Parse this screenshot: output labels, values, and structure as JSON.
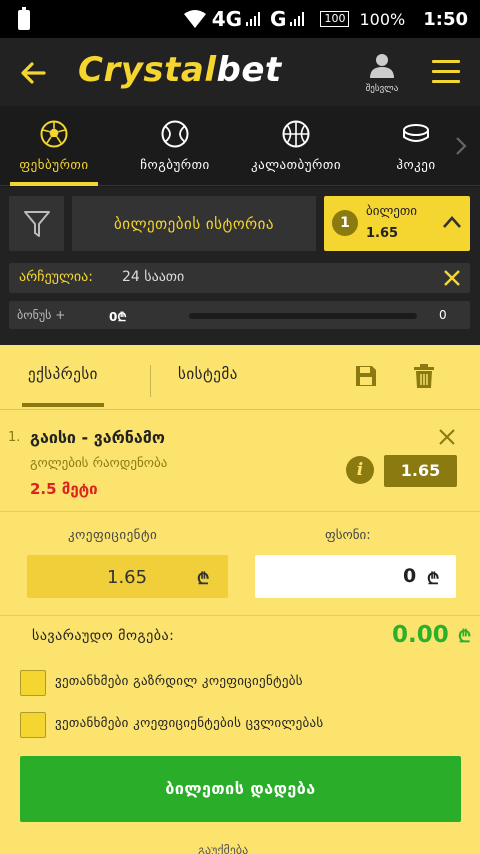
{
  "statusbar": {
    "network": "4G",
    "network2": "G",
    "battery_box": "100",
    "battery_pct": "100%",
    "time": "1:50"
  },
  "header": {
    "logo_main": "Crystal",
    "logo_accent": "bet",
    "account_label": "შესვლა"
  },
  "sports": [
    {
      "label": "ფეხბურთი",
      "icon": "football-icon"
    },
    {
      "label": "ჩოგბურთი",
      "icon": "tennis-icon"
    },
    {
      "label": "კალათბურთი",
      "icon": "basketball-icon"
    },
    {
      "label": "ჰოკეი",
      "icon": "hockey-puck-icon"
    }
  ],
  "ticketbar": {
    "history_label": "ბილეთების ისტორია",
    "ticket_count": "1",
    "ticket_title": "ბილეთი",
    "ticket_odds": "1.65",
    "expire_label": "არჩეულია:",
    "expire_value": "24 საათი",
    "bonus_label": "ბონუს +",
    "bonus_start": "0₾",
    "bonus_end": "0"
  },
  "slip": {
    "tab_express": "ექსპრესი",
    "tab_system": "სისტემა",
    "bet": {
      "number": "1.",
      "match": "გაისი - ვარნამო",
      "market": "გოლების რაოდენობა",
      "outcome": "2.5 მეტი",
      "odds": "1.65",
      "info": "i"
    },
    "odds_label": "კოეფიციენტი",
    "stake_label": "ფსონი:",
    "odds_value": "1.65",
    "currency": "₾",
    "stake_value": "0",
    "payout_label": "სავარაუდო მოგება:",
    "payout_value": "0.00",
    "accept_increased": "ვეთანხმები გაზრდილ კოეფიციენტებს",
    "accept_changes": "ვეთანხმები კოეფიციენტების ცვლილებას",
    "place_bet": "ბილეთის დადება",
    "footer": "გაუქმება"
  },
  "colors": {
    "brand_yellow": "#f5d630",
    "slip_bg": "#fbe36e",
    "accent_olive": "#8b7a10",
    "success_green": "#2aae2a",
    "danger_red": "#dd2222"
  }
}
